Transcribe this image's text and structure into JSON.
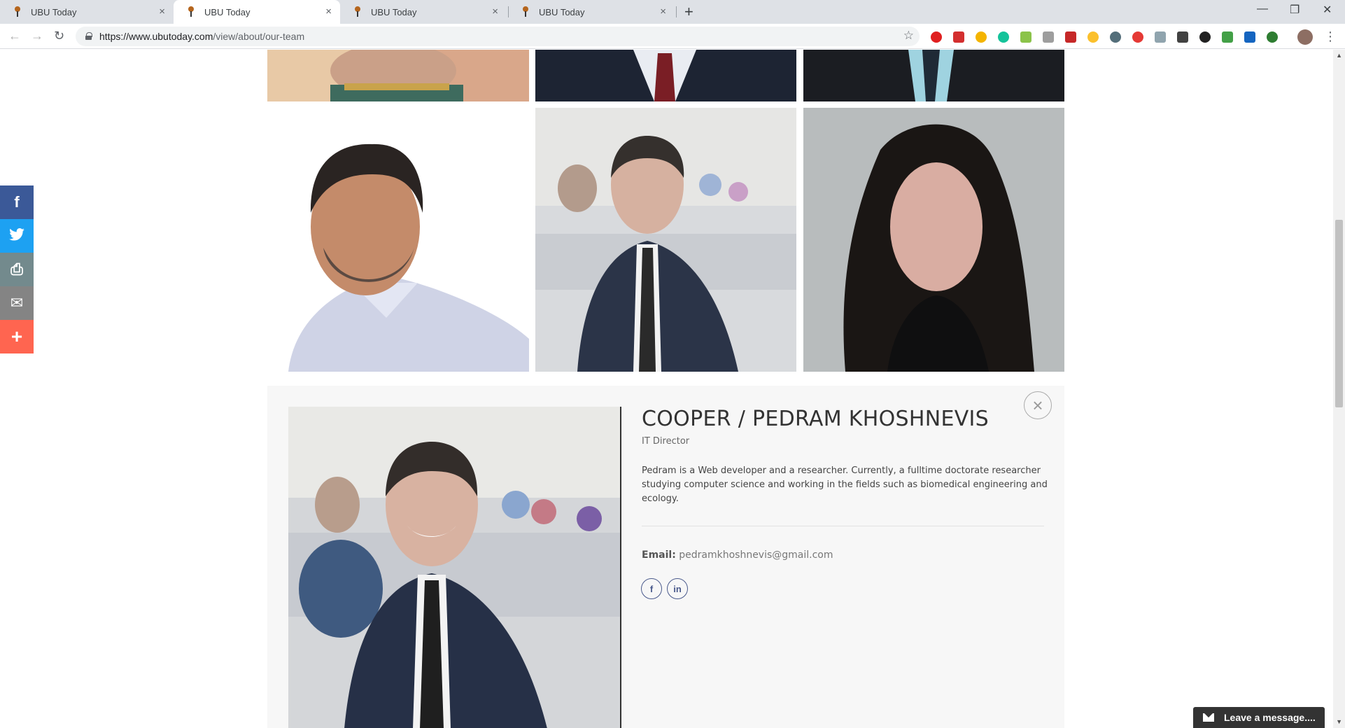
{
  "browser": {
    "tabs": [
      {
        "title": "UBU Today",
        "close": "×"
      },
      {
        "title": "UBU Today",
        "close": "×"
      },
      {
        "title": "UBU Today",
        "close": "×"
      },
      {
        "title": "UBU Today",
        "close": "×"
      }
    ],
    "new_tab": "+",
    "window_controls": {
      "minimize": "—",
      "restore": "❐",
      "close": "✕"
    },
    "nav": {
      "back": "←",
      "forward": "→",
      "reload": "↻"
    },
    "url_host": "https://www.ubutoday.com",
    "url_path": "/view/about/our-team",
    "bookmark": "☆",
    "menu": "⋮"
  },
  "share_bar": {
    "items": [
      {
        "icon": "facebook-icon",
        "glyph": "f",
        "color": "#3b5998"
      },
      {
        "icon": "twitter-icon",
        "glyph": "🐦",
        "color": "#1da1f2"
      },
      {
        "icon": "print-icon",
        "glyph": "⎙",
        "color": "#738a8d"
      },
      {
        "icon": "email-icon",
        "glyph": "✉",
        "color": "#848484"
      },
      {
        "icon": "plus-icon",
        "glyph": "+",
        "color": "#ff6550"
      }
    ]
  },
  "team_member": {
    "name": "COOPER / PEDRAM KHOSHNEVIS",
    "title": "IT Director",
    "bio": "Pedram is a Web developer and a researcher. Currently, a fulltime doctorate researcher studying computer science and working in the fields such as biomedical engineering and ecology.",
    "email_label": "Email:",
    "email": "pedramkhoshnevis@gmail.com",
    "social": {
      "facebook": "f",
      "linkedin": "in"
    },
    "close": "×"
  },
  "chat_widget": {
    "label": "Leave a message...."
  }
}
